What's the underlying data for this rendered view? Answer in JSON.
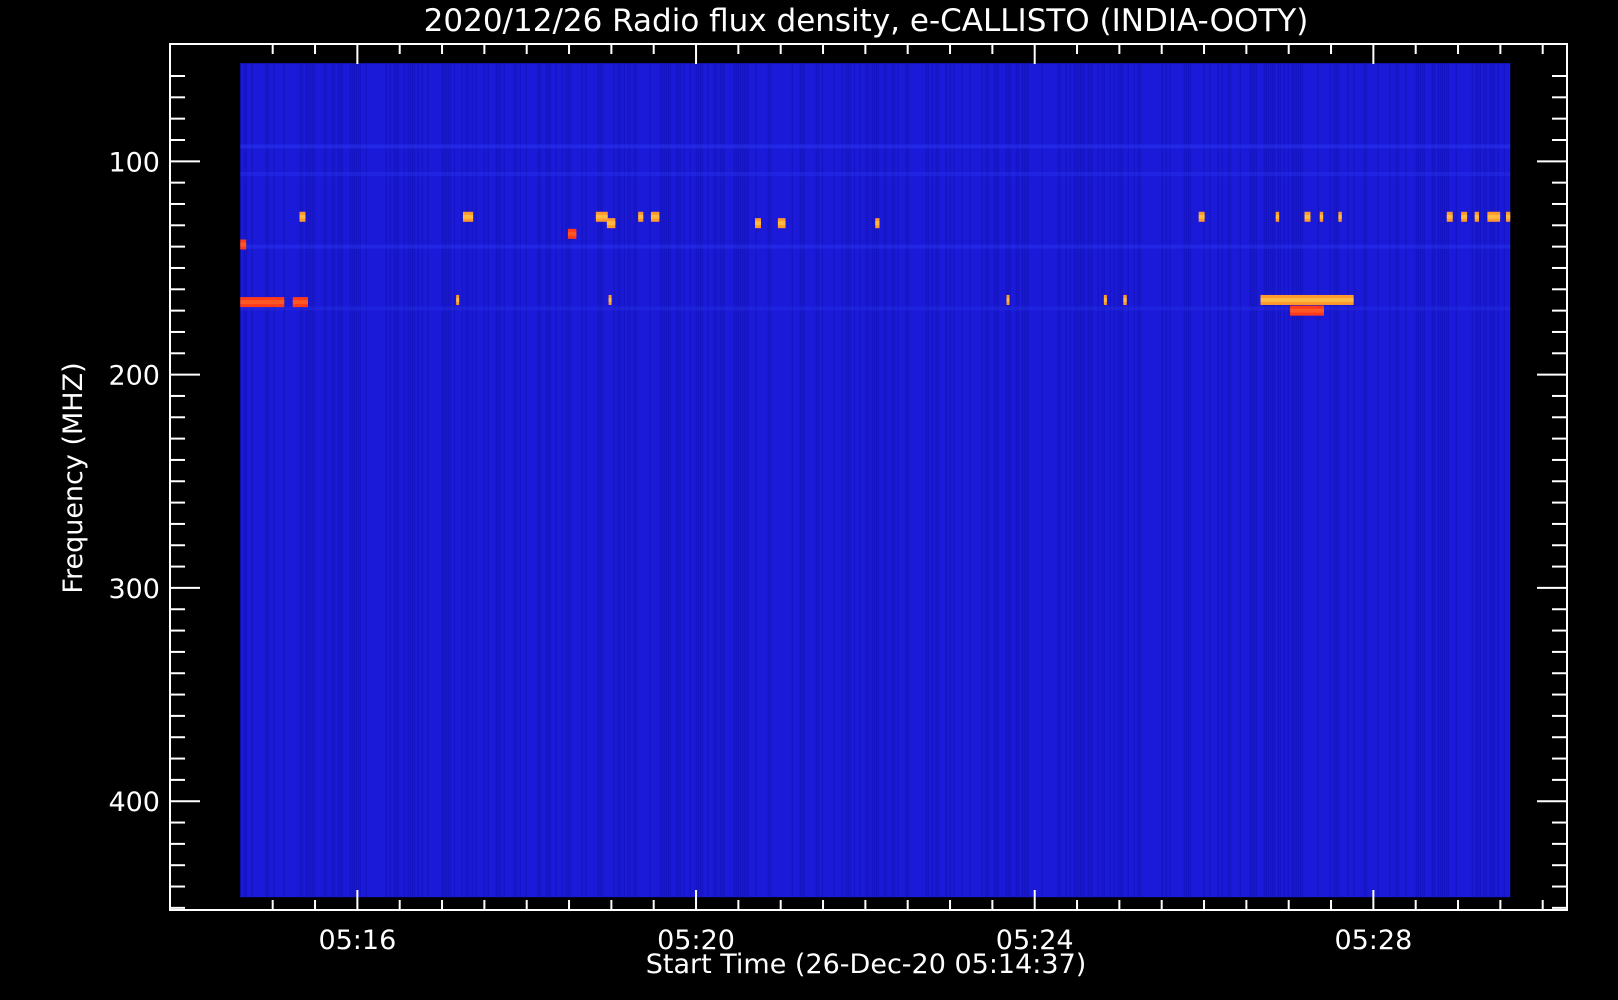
{
  "chart_data": {
    "type": "heatmap",
    "title": "2020/12/26  Radio flux density, e-CALLISTO (INDIA-OOTY)",
    "xlabel": "Start Time (26-Dec-20 05:14:37)",
    "ylabel": "Frequency (MHZ)",
    "x_ticks": [
      {
        "label": "05:16",
        "minutes_after_start": 1.383
      },
      {
        "label": "05:20",
        "minutes_after_start": 5.383
      },
      {
        "label": "05:24",
        "minutes_after_start": 9.383
      },
      {
        "label": "05:28",
        "minutes_after_start": 13.383
      }
    ],
    "xlim_minutes_after_start": [
      -0.83,
      15.67
    ],
    "data_time_range_minutes_after_start": [
      0.0,
      15.0
    ],
    "y_ticks": [
      100,
      200,
      300,
      400
    ],
    "ylim": [
      45,
      451
    ],
    "y_inverted": true,
    "data_freq_range": [
      54,
      445
    ],
    "background_color": "#1a1ad8",
    "colors": {
      "hot": "#ff9a2e",
      "warm": "#ff3a1a",
      "bright": "#ffd050"
    },
    "bursts": [
      {
        "t": 0.7,
        "f": 126,
        "dur": 0.07,
        "level": "hot"
      },
      {
        "t": 2.63,
        "f": 126,
        "dur": 0.12,
        "level": "hot"
      },
      {
        "t": 3.87,
        "f": 134,
        "dur": 0.1,
        "level": "warm"
      },
      {
        "t": 4.2,
        "f": 126,
        "dur": 0.14,
        "level": "hot"
      },
      {
        "t": 4.33,
        "f": 129,
        "dur": 0.1,
        "level": "hot"
      },
      {
        "t": 4.7,
        "f": 126,
        "dur": 0.06,
        "level": "hot"
      },
      {
        "t": 4.85,
        "f": 126,
        "dur": 0.1,
        "level": "hot"
      },
      {
        "t": 6.08,
        "f": 129,
        "dur": 0.07,
        "level": "hot"
      },
      {
        "t": 6.35,
        "f": 129,
        "dur": 0.09,
        "level": "hot"
      },
      {
        "t": 7.5,
        "f": 129,
        "dur": 0.05,
        "level": "hot"
      },
      {
        "t": 11.32,
        "f": 126,
        "dur": 0.07,
        "level": "hot"
      },
      {
        "t": 12.23,
        "f": 126,
        "dur": 0.04,
        "level": "hot"
      },
      {
        "t": 12.57,
        "f": 126,
        "dur": 0.07,
        "level": "hot"
      },
      {
        "t": 12.75,
        "f": 126,
        "dur": 0.04,
        "level": "hot"
      },
      {
        "t": 12.97,
        "f": 126,
        "dur": 0.04,
        "level": "hot"
      },
      {
        "t": 14.25,
        "f": 126,
        "dur": 0.07,
        "level": "hot"
      },
      {
        "t": 14.42,
        "f": 126,
        "dur": 0.07,
        "level": "hot"
      },
      {
        "t": 14.58,
        "f": 126,
        "dur": 0.05,
        "level": "hot"
      },
      {
        "t": 14.73,
        "f": 126,
        "dur": 0.15,
        "level": "hot"
      },
      {
        "t": 14.95,
        "f": 126,
        "dur": 0.05,
        "level": "hot"
      },
      {
        "t": 0.0,
        "f": 139,
        "dur": 0.07,
        "level": "warm"
      },
      {
        "t": 0.0,
        "f": 166,
        "dur": 0.52,
        "level": "warm"
      },
      {
        "t": 0.62,
        "f": 166,
        "dur": 0.18,
        "level": "warm"
      },
      {
        "t": 2.55,
        "f": 165,
        "dur": 0.03,
        "level": "hot"
      },
      {
        "t": 4.35,
        "f": 165,
        "dur": 0.03,
        "level": "hot"
      },
      {
        "t": 9.05,
        "f": 165,
        "dur": 0.03,
        "level": "hot"
      },
      {
        "t": 10.2,
        "f": 165,
        "dur": 0.03,
        "level": "hot"
      },
      {
        "t": 10.43,
        "f": 165,
        "dur": 0.04,
        "level": "hot"
      },
      {
        "t": 12.05,
        "f": 165,
        "dur": 1.1,
        "level": "hot"
      },
      {
        "t": 12.4,
        "f": 170,
        "dur": 0.4,
        "level": "warm"
      }
    ],
    "rfi_bands": [
      {
        "f": 93,
        "t0": 0.0,
        "t1": 15.0,
        "strength": 0.35
      },
      {
        "f": 106,
        "t0": 0.0,
        "t1": 15.0,
        "strength": 0.25
      },
      {
        "f": 140,
        "t0": 0.0,
        "t1": 15.0,
        "strength": 0.3
      },
      {
        "f": 169,
        "t0": 0.0,
        "t1": 15.0,
        "strength": 0.22
      }
    ]
  }
}
